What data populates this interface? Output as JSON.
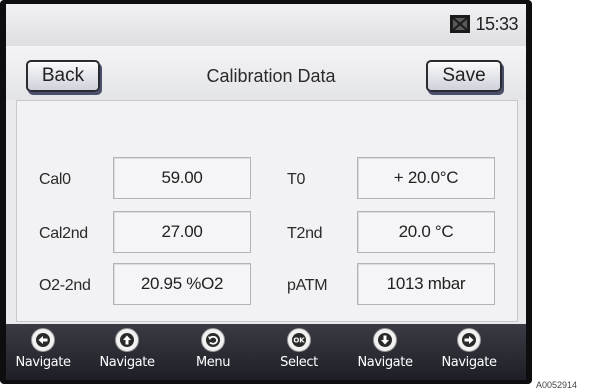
{
  "status": {
    "time": "15:33",
    "card_icon": "sd-card-icon"
  },
  "header": {
    "back_label": "Back",
    "title": "Calibration Data",
    "save_label": "Save"
  },
  "fields": {
    "cal0": {
      "label": "Cal0",
      "value": "59.00"
    },
    "cal2nd": {
      "label": "Cal2nd",
      "value": "27.00"
    },
    "o2_2nd": {
      "label": "O2-2nd",
      "value": "20.95  %O2"
    },
    "t0": {
      "label": "T0",
      "value": "+ 20.0°C"
    },
    "t2nd": {
      "label": "T2nd",
      "value": "20.0 °C"
    },
    "patm": {
      "label": "pATM",
      "value": "1013  mbar"
    }
  },
  "nav": {
    "items": [
      {
        "label": "Navigate",
        "icon": "arrow-left-icon"
      },
      {
        "label": "Navigate",
        "icon": "arrow-up-icon"
      },
      {
        "label": "Menu",
        "icon": "back-circle-icon"
      },
      {
        "label": "Select",
        "icon": "ok-icon"
      },
      {
        "label": "Navigate",
        "icon": "arrow-down-icon"
      },
      {
        "label": "Navigate",
        "icon": "arrow-right-icon"
      }
    ]
  },
  "figure_code": "A0052914"
}
